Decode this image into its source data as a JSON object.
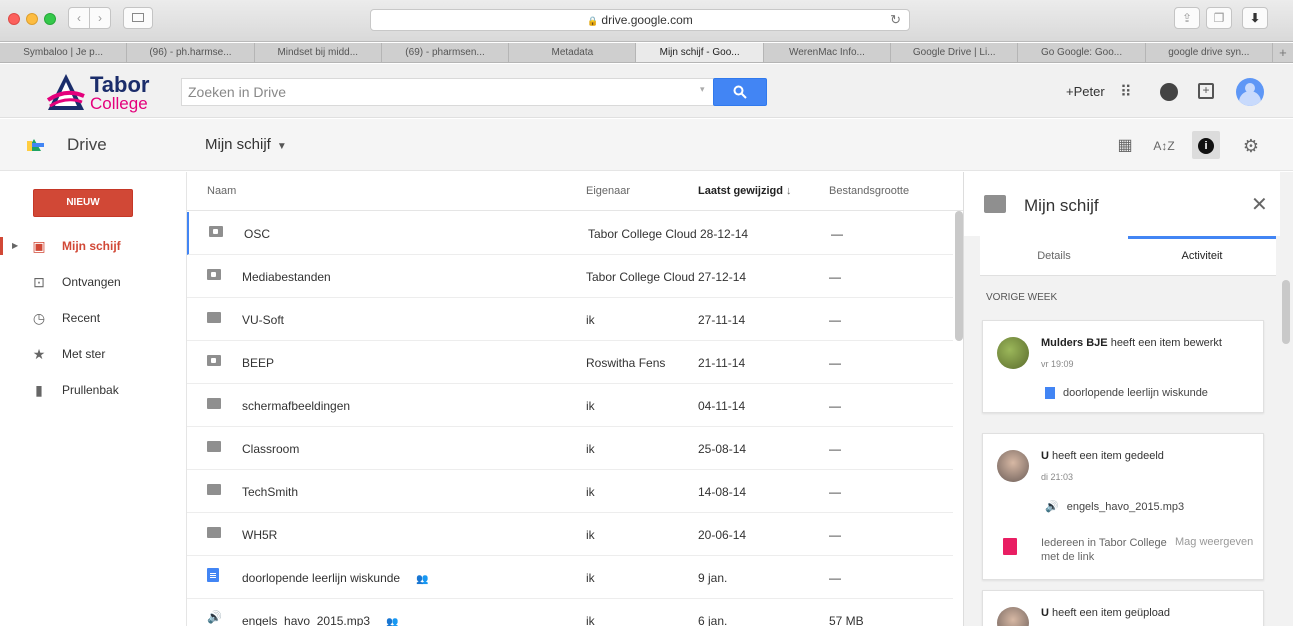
{
  "browser": {
    "url": "drive.google.com",
    "tabs": [
      {
        "label": "Symbaloo | Je p...",
        "active": false
      },
      {
        "label": "(96) - ph.harmse...",
        "active": false
      },
      {
        "label": "Mindset bij midd...",
        "active": false
      },
      {
        "label": "(69) - pharmsen...",
        "active": false
      },
      {
        "label": "Metadata",
        "active": false
      },
      {
        "label": "Mijn schijf - Goo...",
        "active": true
      },
      {
        "label": "WerenMac Info...",
        "active": false
      },
      {
        "label": "Google Drive | Li...",
        "active": false
      },
      {
        "label": "Go Google: Goo...",
        "active": false
      },
      {
        "label": "google drive syn...",
        "active": false
      }
    ],
    "new_tab_label": "+"
  },
  "header": {
    "logo_line1": "Tabor",
    "logo_line2": "College",
    "search_placeholder": "Zoeken in Drive",
    "user_label": "+Peter"
  },
  "toolbar": {
    "app_label": "Drive",
    "location": "Mijn schijf"
  },
  "leftnav": {
    "new_label": "NIEUW",
    "items": [
      {
        "label": "Mijn schijf",
        "icon": "drive-folder-icon",
        "active": true
      },
      {
        "label": "Ontvangen",
        "icon": "inbox-icon",
        "active": false
      },
      {
        "label": "Recent",
        "icon": "clock-icon",
        "active": false
      },
      {
        "label": "Met ster",
        "icon": "star-icon",
        "active": false
      },
      {
        "label": "Prullenbak",
        "icon": "trash-icon",
        "active": false
      }
    ]
  },
  "filelist": {
    "columns": {
      "name": "Naam",
      "owner": "Eigenaar",
      "modified": "Laatst gewijzigd",
      "size": "Bestandsgrootte"
    },
    "rows": [
      {
        "name": "OSC",
        "owner": "Tabor College Cloud Drive",
        "date": "28-12-14",
        "size": "—",
        "type": "shared-folder",
        "shared": false
      },
      {
        "name": "Mediabestanden",
        "owner": "Tabor College Cloud Drive",
        "date": "27-12-14",
        "size": "—",
        "type": "shared-folder",
        "shared": false
      },
      {
        "name": "VU-Soft",
        "owner": "ik",
        "date": "27-11-14",
        "size": "—",
        "type": "folder",
        "shared": false
      },
      {
        "name": "BEEP",
        "owner": "Roswitha Fens",
        "date": "21-11-14",
        "size": "—",
        "type": "shared-folder",
        "shared": false
      },
      {
        "name": "schermafbeeldingen",
        "owner": "ik",
        "date": "04-11-14",
        "size": "—",
        "type": "folder",
        "shared": false
      },
      {
        "name": "Classroom",
        "owner": "ik",
        "date": "25-08-14",
        "size": "—",
        "type": "folder",
        "shared": false
      },
      {
        "name": "TechSmith",
        "owner": "ik",
        "date": "14-08-14",
        "size": "—",
        "type": "folder",
        "shared": false
      },
      {
        "name": "WH5R",
        "owner": "ik",
        "date": "20-06-14",
        "size": "—",
        "type": "folder",
        "shared": false
      },
      {
        "name": "doorlopende leerlijn wiskunde",
        "owner": "ik",
        "date": "9 jan.",
        "size": "—",
        "type": "doc",
        "shared": true
      },
      {
        "name": "engels_havo_2015.mp3",
        "owner": "ik",
        "date": "6 jan.",
        "size": "57 MB",
        "type": "audio",
        "shared": true
      }
    ]
  },
  "panel": {
    "title": "Mijn schijf",
    "tab_details": "Details",
    "tab_activity": "Activiteit",
    "section_label": "VORIGE WEEK",
    "activities": [
      {
        "actor": "Mulders BJE",
        "action": " heeft een item bewerkt",
        "time": "vr 19:09",
        "file": "doorlopende leerlijn wiskunde"
      },
      {
        "actor": "U",
        "action": " heeft een item gedeeld",
        "time": "di 21:03",
        "file": "engels_havo_2015.mp3",
        "share_who": "Iedereen in Tabor College met de link",
        "permission": "Mag weergeven"
      },
      {
        "actor": "U",
        "action": " heeft een item geüpload"
      }
    ]
  },
  "colors": {
    "accent_red": "#d14836",
    "google_blue": "#4285f4"
  }
}
